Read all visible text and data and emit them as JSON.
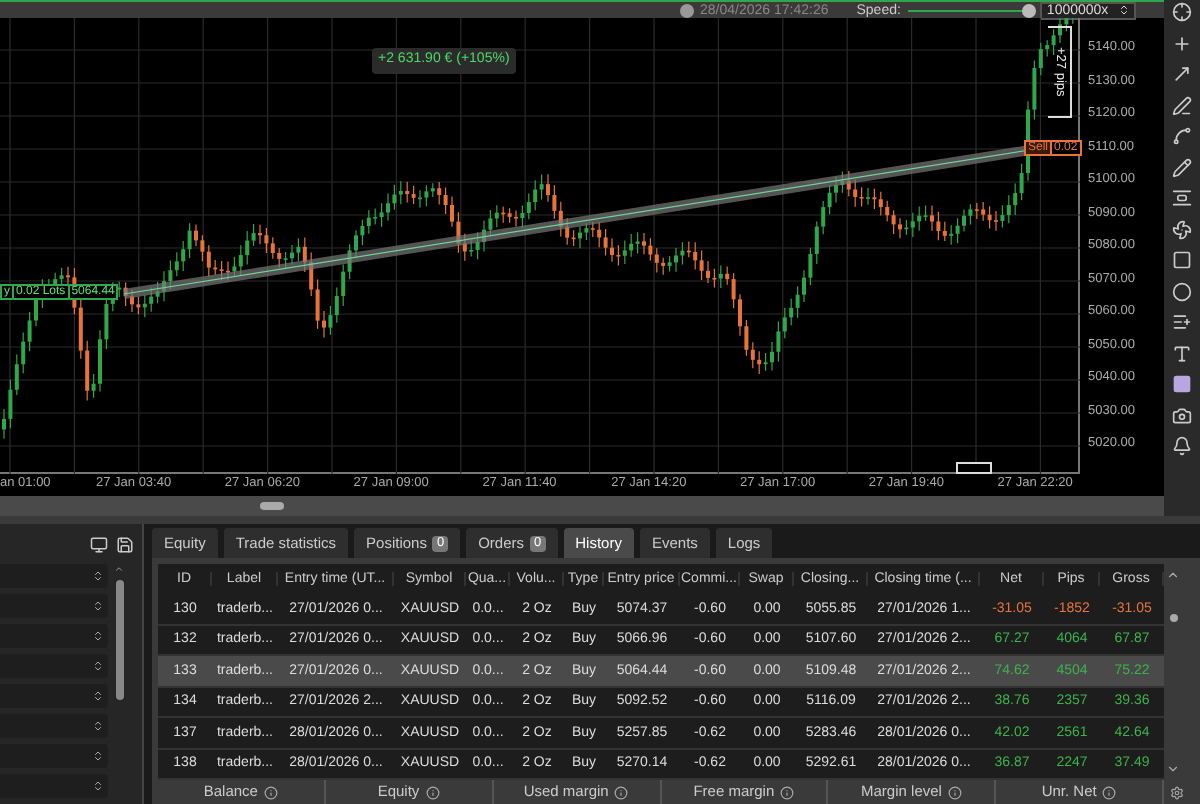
{
  "top_bar": {
    "datetime": "28/04/2026 17:42:26",
    "speed_label": "Speed:",
    "speed": {
      "level": 1,
      "value": "1000000x"
    }
  },
  "chart": {
    "profit_badge": "+2 631.90 € (+105%)",
    "pips_label": "+27 pips",
    "sell_label": {
      "side": "Sell",
      "volume": "0.02"
    },
    "buy_label": {
      "side": "y",
      "volume": "0.02 Lots",
      "price": "5064.44"
    },
    "price_axis": [
      "5140.00",
      "5130.00",
      "5120.00",
      "5110.00",
      "5100.00",
      "5090.00",
      "5080.00",
      "5070.00",
      "5060.00",
      "5050.00",
      "5040.00",
      "5030.00",
      "5020.00"
    ],
    "time_axis": [
      "an 01:00",
      "27 Jan 03:40",
      "27 Jan 06:20",
      "27 Jan 09:00",
      "27 Jan 11:40",
      "27 Jan 14:20",
      "27 Jan 17:00",
      "27 Jan 19:40",
      "27 Jan 22:20"
    ]
  },
  "tabs": [
    {
      "label": "Equity",
      "selected": false
    },
    {
      "label": "Trade statistics",
      "selected": false
    },
    {
      "label": "Positions",
      "count": "0",
      "selected": false
    },
    {
      "label": "Orders",
      "count": "0",
      "selected": false
    },
    {
      "label": "History",
      "selected": true
    },
    {
      "label": "Events",
      "selected": false
    },
    {
      "label": "Logs",
      "selected": false
    }
  ],
  "table": {
    "columns": [
      "ID",
      "Label",
      "Entry time (UT...",
      "Symbol",
      "Qua...",
      "Volu...",
      "Type",
      "Entry price",
      "Commi...",
      "Swap",
      "Closing...",
      "Closing time (...",
      "Net",
      "Pips",
      "Gross"
    ],
    "rows": [
      {
        "selected": false,
        "color": "#e8743b",
        "cells": [
          "130",
          "traderb...",
          "27/01/2026 0...",
          "XAUUSD",
          "0.0...",
          "2 Oz",
          "Buy",
          "5074.37",
          "-0.60",
          "0.00",
          "5055.85",
          "27/01/2026 1...",
          "-31.05",
          "-1852",
          "-31.05"
        ]
      },
      {
        "selected": false,
        "color": "#3cb44b",
        "cells": [
          "132",
          "traderb...",
          "27/01/2026 0...",
          "XAUUSD",
          "0.0...",
          "2 Oz",
          "Buy",
          "5066.96",
          "-0.60",
          "0.00",
          "5107.60",
          "27/01/2026 2...",
          "67.27",
          "4064",
          "67.87"
        ]
      },
      {
        "selected": true,
        "color": "#3cb44b",
        "cells": [
          "133",
          "traderb...",
          "27/01/2026 0...",
          "XAUUSD",
          "0.0...",
          "2 Oz",
          "Buy",
          "5064.44",
          "-0.60",
          "0.00",
          "5109.48",
          "27/01/2026 2...",
          "74.62",
          "4504",
          "75.22"
        ]
      },
      {
        "selected": false,
        "color": "#3cb44b",
        "cells": [
          "134",
          "traderb...",
          "27/01/2026 2...",
          "XAUUSD",
          "0.0...",
          "2 Oz",
          "Buy",
          "5092.52",
          "-0.60",
          "0.00",
          "5116.09",
          "27/01/2026 2...",
          "38.76",
          "2357",
          "39.36"
        ]
      },
      {
        "selected": false,
        "color": "#3cb44b",
        "cells": [
          "137",
          "traderb...",
          "28/01/2026 0...",
          "XAUUSD",
          "0.0...",
          "2 Oz",
          "Buy",
          "5257.85",
          "-0.62",
          "0.00",
          "5283.46",
          "28/01/2026 0...",
          "42.02",
          "2561",
          "42.64"
        ]
      },
      {
        "selected": false,
        "color": "#3cb44b",
        "cells": [
          "138",
          "traderb...",
          "28/01/2026 0...",
          "XAUUSD",
          "0.0...",
          "2 Oz",
          "Buy",
          "5270.14",
          "-0.62",
          "0.00",
          "5292.61",
          "28/01/2026 0...",
          "36.87",
          "2247",
          "37.49"
        ]
      }
    ]
  },
  "footer": [
    "Balance",
    "Equity",
    "Used margin",
    "Free margin",
    "Margin level",
    "Unr. Net"
  ]
}
